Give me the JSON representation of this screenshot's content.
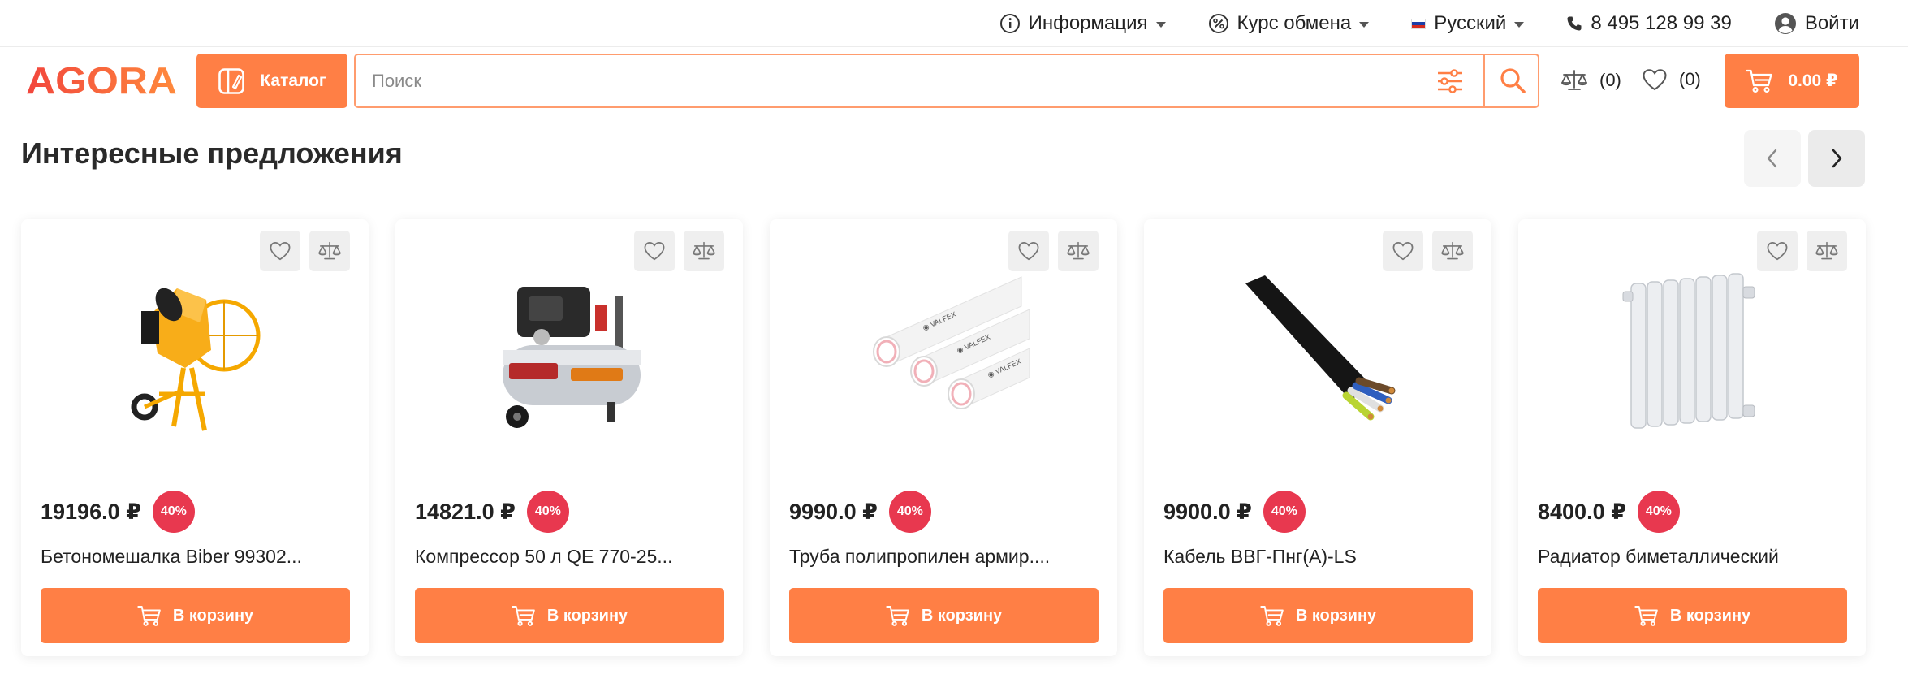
{
  "topbar": {
    "info_label": "Информация",
    "currency_label": "Курс обмена",
    "language_label": "Русский",
    "phone": "8 495 128 99 39",
    "login_label": "Войти"
  },
  "header": {
    "logo_text": "AGORA",
    "catalog_label": "Каталог",
    "search_placeholder": "Поиск",
    "search_value": "",
    "compare_count": "(0)",
    "favorites_count": "(0)",
    "cart_total": "0.00 ₽"
  },
  "colors": {
    "accent": "#ff7f45",
    "badge": "#e8384f"
  },
  "section": {
    "title": "Интересные предложения"
  },
  "products": [
    {
      "price": "19196.0 ₽",
      "discount": "40%",
      "name": "Бетономешалка Biber 99302...",
      "buy_label": "В корзину",
      "image": "concrete-mixer"
    },
    {
      "price": "14821.0 ₽",
      "discount": "40%",
      "name": "Компрессор 50 л QE 770-25...",
      "buy_label": "В корзину",
      "image": "air-compressor"
    },
    {
      "price": "9990.0 ₽",
      "discount": "40%",
      "name": "Труба полипропилен армир....",
      "buy_label": "В корзину",
      "image": "pipes"
    },
    {
      "price": "9900.0 ₽",
      "discount": "40%",
      "name": "Кабель ВВГ-Пнг(А)-LS",
      "buy_label": "В корзину",
      "image": "cable"
    },
    {
      "price": "8400.0 ₽",
      "discount": "40%",
      "name": "Радиатор биметаллический",
      "buy_label": "В корзину",
      "image": "radiator"
    }
  ]
}
